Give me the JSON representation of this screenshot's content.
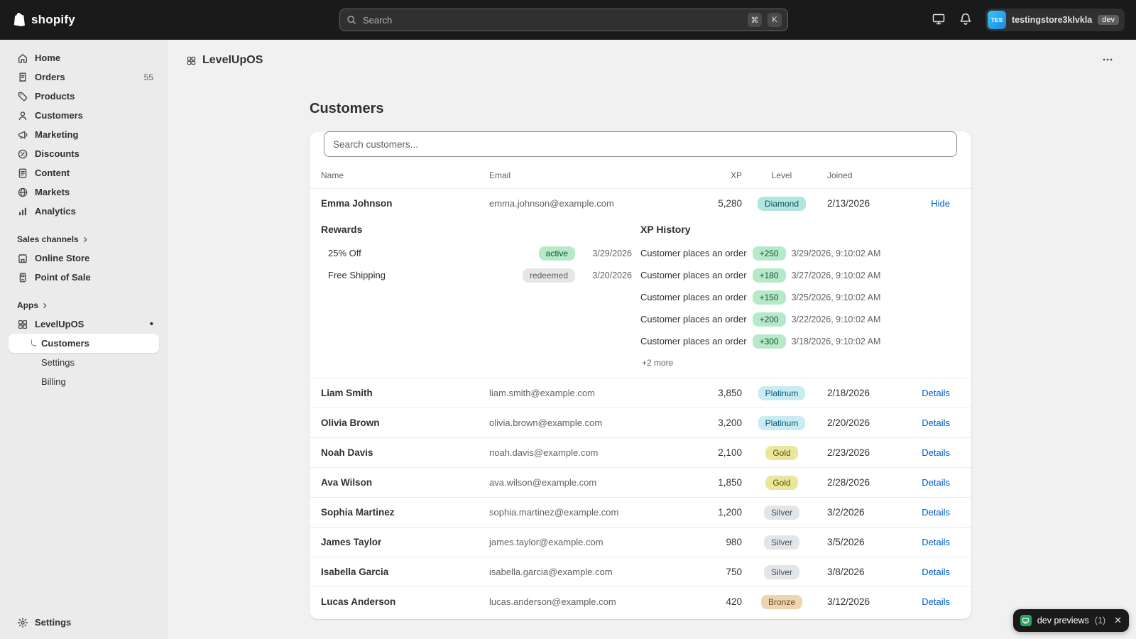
{
  "topbar": {
    "brand": "shopify",
    "search_placeholder": "Search",
    "shortcut": [
      "⌘",
      "K"
    ],
    "store_name": "testingstore3klvkla",
    "store_badge": "dev",
    "avatar_initials": "TES"
  },
  "sidebar": {
    "items": [
      {
        "id": "home",
        "label": "Home",
        "icon": "home-icon"
      },
      {
        "id": "orders",
        "label": "Orders",
        "icon": "orders-icon",
        "count": "55"
      },
      {
        "id": "products",
        "label": "Products",
        "icon": "tag-icon"
      },
      {
        "id": "customers",
        "label": "Customers",
        "icon": "person-icon"
      },
      {
        "id": "marketing",
        "label": "Marketing",
        "icon": "megaphone-icon"
      },
      {
        "id": "discounts",
        "label": "Discounts",
        "icon": "discount-icon"
      },
      {
        "id": "content",
        "label": "Content",
        "icon": "document-icon"
      },
      {
        "id": "markets",
        "label": "Markets",
        "icon": "globe-icon"
      },
      {
        "id": "analytics",
        "label": "Analytics",
        "icon": "chart-icon"
      }
    ],
    "sales_channels_label": "Sales channels",
    "sales_channels": [
      {
        "id": "online-store",
        "label": "Online Store",
        "icon": "storefront-icon"
      },
      {
        "id": "point-of-sale",
        "label": "Point of Sale",
        "icon": "pos-icon"
      }
    ],
    "apps_label": "Apps",
    "app": {
      "label": "LevelUpOS",
      "indicator": "•"
    },
    "app_children": [
      {
        "id": "customers",
        "label": "Customers",
        "active": true,
        "connector": true
      },
      {
        "id": "settings",
        "label": "Settings"
      },
      {
        "id": "billing",
        "label": "Billing"
      }
    ],
    "settings_label": "Settings"
  },
  "header": {
    "title": "LevelUpOS"
  },
  "page": {
    "title": "Customers",
    "search_placeholder": "Search customers..."
  },
  "table": {
    "columns": [
      "Name",
      "Email",
      "XP",
      "Level",
      "Joined"
    ],
    "rows": [
      {
        "name": "Emma Johnson",
        "email": "emma.johnson@example.com",
        "xp": "5,280",
        "level": "Diamond",
        "joined": "2/13/2026",
        "action": "Hide",
        "expanded": true
      },
      {
        "name": "Liam Smith",
        "email": "liam.smith@example.com",
        "xp": "3,850",
        "level": "Platinum",
        "joined": "2/18/2026",
        "action": "Details"
      },
      {
        "name": "Olivia Brown",
        "email": "olivia.brown@example.com",
        "xp": "3,200",
        "level": "Platinum",
        "joined": "2/20/2026",
        "action": "Details"
      },
      {
        "name": "Noah Davis",
        "email": "noah.davis@example.com",
        "xp": "2,100",
        "level": "Gold",
        "joined": "2/23/2026",
        "action": "Details"
      },
      {
        "name": "Ava Wilson",
        "email": "ava.wilson@example.com",
        "xp": "1,850",
        "level": "Gold",
        "joined": "2/28/2026",
        "action": "Details"
      },
      {
        "name": "Sophia Martinez",
        "email": "sophia.martinez@example.com",
        "xp": "1,200",
        "level": "Silver",
        "joined": "3/2/2026",
        "action": "Details"
      },
      {
        "name": "James Taylor",
        "email": "james.taylor@example.com",
        "xp": "980",
        "level": "Silver",
        "joined": "3/5/2026",
        "action": "Details"
      },
      {
        "name": "Isabella Garcia",
        "email": "isabella.garcia@example.com",
        "xp": "750",
        "level": "Silver",
        "joined": "3/8/2026",
        "action": "Details"
      },
      {
        "name": "Lucas Anderson",
        "email": "lucas.anderson@example.com",
        "xp": "420",
        "level": "Bronze",
        "joined": "3/12/2026",
        "action": "Details"
      }
    ]
  },
  "detail": {
    "rewards_title": "Rewards",
    "rewards": [
      {
        "name": "25% Off",
        "status": "active",
        "date": "3/29/2026"
      },
      {
        "name": "Free Shipping",
        "status": "redeemed",
        "date": "3/20/2026"
      }
    ],
    "xp_history_title": "XP History",
    "xp_history": [
      {
        "event": "Customer places an order",
        "xp": "+250",
        "date": "3/29/2026, 9:10:02 AM"
      },
      {
        "event": "Customer places an order",
        "xp": "+180",
        "date": "3/27/2026, 9:10:02 AM"
      },
      {
        "event": "Customer places an order",
        "xp": "+150",
        "date": "3/25/2026, 9:10:02 AM"
      },
      {
        "event": "Customer places an order",
        "xp": "+200",
        "date": "3/22/2026, 9:10:02 AM"
      },
      {
        "event": "Customer places an order",
        "xp": "+300",
        "date": "3/18/2026, 9:10:02 AM"
      }
    ],
    "more_label": "+2 more"
  },
  "toast": {
    "label": "dev previews",
    "count": "(1)",
    "close": "✕"
  },
  "colors": {
    "levels": {
      "Diamond": {
        "bg": "#b0e5e0",
        "fg": "#0e5a54"
      },
      "Platinum": {
        "bg": "#c9ecf3",
        "fg": "#0e5b7e"
      },
      "Gold": {
        "bg": "#eae79d",
        "fg": "#5a5300"
      },
      "Silver": {
        "bg": "#e3e6e9",
        "fg": "#494f55"
      },
      "Bronze": {
        "bg": "#ecd5b0",
        "fg": "#6d4f22"
      }
    },
    "status": {
      "active": {
        "bg": "#b7e9c8",
        "fg": "#0b5437"
      },
      "redeemed": {
        "bg": "#e6e6e6",
        "fg": "#5c5c5c"
      }
    },
    "xp_badge": {
      "bg": "#b7e9c8",
      "fg": "#0b5437"
    },
    "link": "#005bd3"
  }
}
